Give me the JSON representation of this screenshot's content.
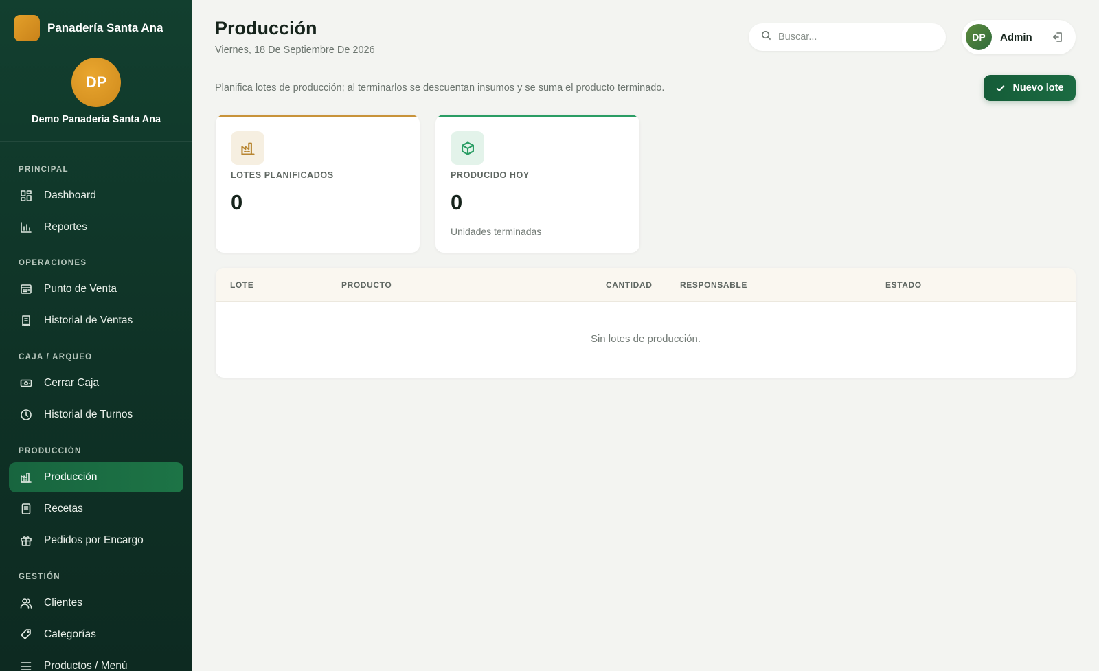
{
  "brand": {
    "name": "Panadería Santa Ana"
  },
  "profile": {
    "initials": "DP",
    "name": "Demo Panadería Santa Ana"
  },
  "sidebar": {
    "sections": [
      {
        "title": "PRINCIPAL"
      },
      {
        "title": "OPERACIONES"
      },
      {
        "title": "CAJA / ARQUEO"
      },
      {
        "title": "PRODUCCIÓN"
      },
      {
        "title": "GESTIÓN"
      }
    ],
    "items": [
      {
        "label": "Dashboard",
        "icon": "dashboard-icon"
      },
      {
        "label": "Reportes",
        "icon": "bar-chart-icon"
      },
      {
        "label": "Punto de Venta",
        "icon": "register-icon"
      },
      {
        "label": "Historial de Ventas",
        "icon": "receipt-icon"
      },
      {
        "label": "Cerrar Caja",
        "icon": "cash-icon"
      },
      {
        "label": "Historial de Turnos",
        "icon": "clock-icon"
      },
      {
        "label": "Producción",
        "icon": "factory-icon",
        "active": true
      },
      {
        "label": "Recetas",
        "icon": "recipe-book-icon"
      },
      {
        "label": "Pedidos por Encargo",
        "icon": "gift-icon"
      },
      {
        "label": "Clientes",
        "icon": "users-icon"
      },
      {
        "label": "Categorías",
        "icon": "tag-icon"
      },
      {
        "label": "Productos / Menú",
        "icon": "menu-list-icon"
      }
    ]
  },
  "header": {
    "title": "Producción",
    "date": "Viernes, 18 De Septiembre De 2026",
    "search_placeholder": "Buscar...",
    "user": {
      "initials": "DP",
      "name": "Admin"
    }
  },
  "main": {
    "description": "Planifica lotes de producción; al terminarlos se descuentan insumos y se suma el producto terminado.",
    "new_button_label": "Nuevo lote",
    "stats": [
      {
        "label": "LOTES PLANIFICADOS",
        "value": "0",
        "subtitle": "",
        "icon": "factory-icon",
        "accent": "#c8933a"
      },
      {
        "label": "PRODUCIDO HOY",
        "value": "0",
        "subtitle": "Unidades terminadas",
        "icon": "box-icon",
        "accent": "#2a9d64"
      }
    ],
    "table": {
      "columns": [
        "LOTE",
        "PRODUCTO",
        "CANTIDAD",
        "RESPONSABLE",
        "ESTADO"
      ],
      "rows": [],
      "empty_message": "Sin lotes de producción."
    }
  },
  "colors": {
    "sidebar_bg": "#0f3226",
    "active_item": "#1d7446",
    "primary_button": "#155c38",
    "brand_orange": "#e3a02a"
  }
}
